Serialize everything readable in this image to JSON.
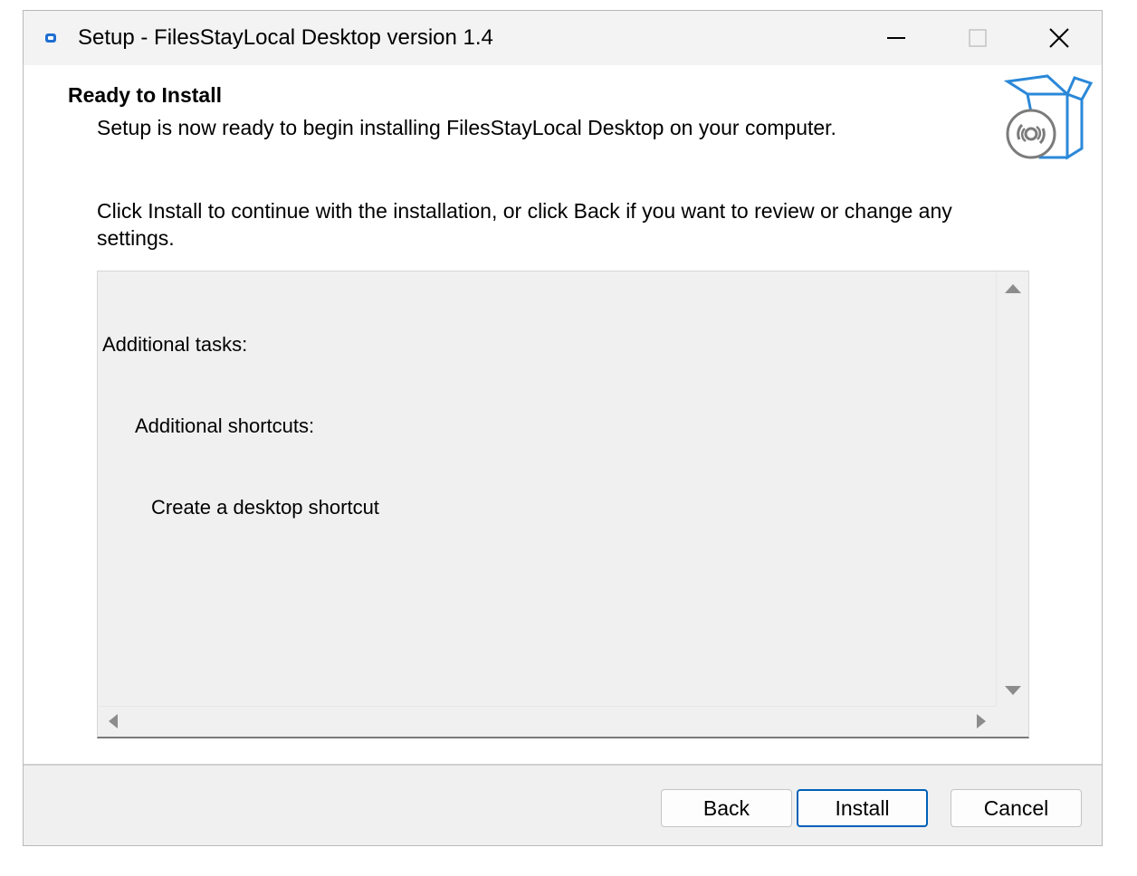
{
  "window": {
    "title": "Setup - FilesStayLocal Desktop version 1.4"
  },
  "page": {
    "heading": "Ready to Install",
    "subheading": "Setup is now ready to begin installing FilesStayLocal Desktop on your computer.",
    "instruction": "Click Install to continue with the installation, or click Back if you want to review or change any settings."
  },
  "memo": {
    "lines": [
      "Additional tasks:",
      "Additional shortcuts:",
      "Create a desktop shortcut"
    ]
  },
  "buttons": {
    "back": "Back",
    "install": "Install",
    "cancel": "Cancel"
  },
  "colors": {
    "accent": "#005fb8",
    "icon_blue": "#2b88d8"
  }
}
